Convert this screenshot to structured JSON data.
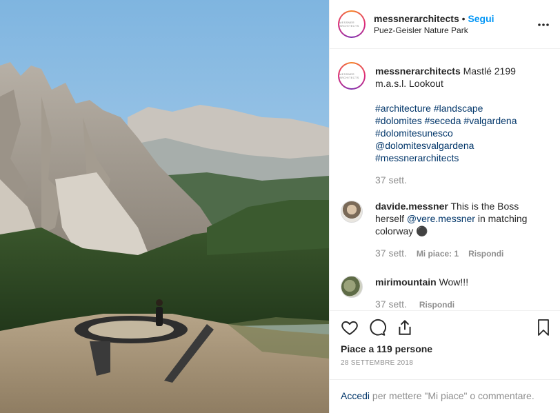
{
  "post": {
    "username": "messnerarchitects",
    "follow_separator": "•",
    "follow_label": "Segui",
    "location": "Puez-Geisler Nature Park",
    "avatar_text": "MESSNER ARCHITECTS",
    "more_icon": "more-options-icon"
  },
  "caption": {
    "username": "messnerarchitects",
    "text": "Mastlé 2199 m.a.s.l. Lookout",
    "hashtags_line1": "#architecture #landscape",
    "hashtags_line2": "#dolomites #seceda #valgardena",
    "hashtags_line3": "#dolomitesunesco",
    "mention_line": "@dolomitesvalgardena",
    "hashtags_line4": "#messnerarchitects",
    "time": "37 sett."
  },
  "comments": [
    {
      "username": "davide.messner",
      "text_before": "This is the Boss herself",
      "mention": "@vere.messner",
      "text_after": "in matching colorway",
      "emoji": "⚫",
      "time": "37 sett.",
      "likes": "Mi piace: 1",
      "reply": "Rispondi"
    },
    {
      "username": "mirimountain",
      "text": "Wow!!!",
      "time": "37 sett.",
      "reply": "Rispondi"
    }
  ],
  "actions": {
    "likes_text": "Piace a 119 persone",
    "date": "28 SETTEMBRE 2018",
    "icons": [
      "heart-icon",
      "comment-icon",
      "share-icon",
      "bookmark-icon"
    ]
  },
  "comment_box": {
    "login_link": "Accedi",
    "prompt": "per mettere \"Mi piace\" o commentare."
  },
  "colors": {
    "accent": "#0095f6",
    "link": "#003569",
    "muted": "#8e8e8e",
    "text": "#262626",
    "sky": "#8fbde2"
  }
}
